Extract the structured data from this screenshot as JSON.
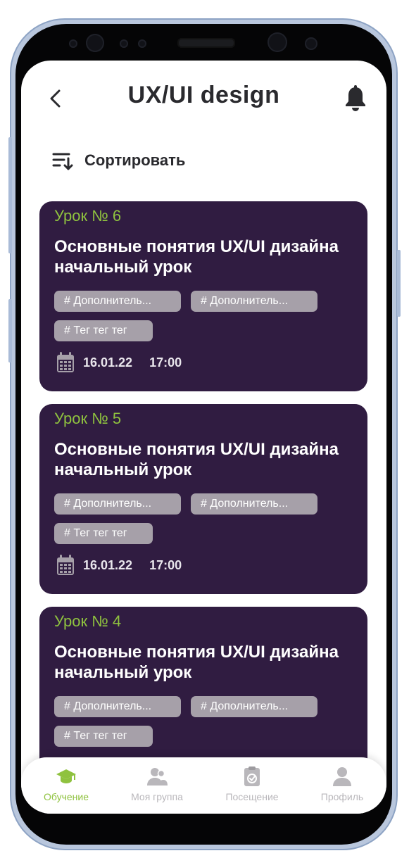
{
  "header": {
    "title": "UX/UI design"
  },
  "sort": {
    "label": "Сортировать"
  },
  "lessons": [
    {
      "number": "Урок № 6",
      "title": "Основные понятия UX/UI дизайна начальный урок",
      "tags": [
        "# Дополнитель...",
        "# Дополнитель...",
        "# Тег тег тег"
      ],
      "date": "16.01.22",
      "time": "17:00"
    },
    {
      "number": "Урок № 5",
      "title": "Основные понятия UX/UI дизайна начальный урок",
      "tags": [
        "# Дополнитель...",
        "# Дополнитель...",
        "# Тег тег тег"
      ],
      "date": "16.01.22",
      "time": "17:00"
    },
    {
      "number": "Урок № 4",
      "title": "Основные понятия UX/UI дизайна начальный урок",
      "tags": [
        "# Дополнитель...",
        "# Дополнитель...",
        "# Тег тег тег"
      ]
    }
  ],
  "nav": {
    "items": [
      {
        "label": "Обучение",
        "icon": "graduation-cap-icon",
        "active": true
      },
      {
        "label": "Моя группа",
        "icon": "group-icon",
        "active": false
      },
      {
        "label": "Посещение",
        "icon": "clipboard-check-icon",
        "active": false
      },
      {
        "label": "Профиль",
        "icon": "profile-icon",
        "active": false
      }
    ]
  },
  "colors": {
    "card_bg": "#301c41",
    "accent": "#8fc23f",
    "tag_bg": "#a6a0a9",
    "nav_inactive": "#b9b7bb"
  }
}
